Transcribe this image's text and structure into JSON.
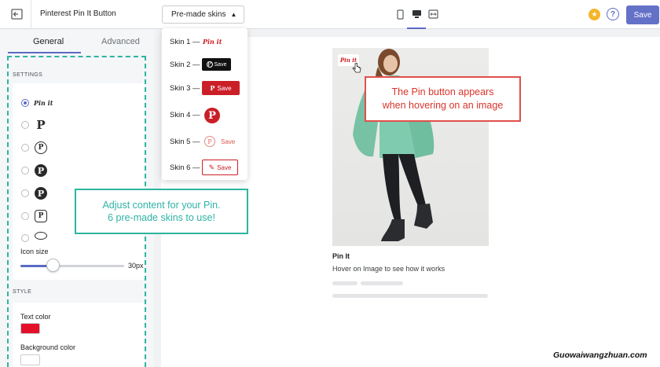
{
  "topbar": {
    "app_title": "Pinterest Pin It Button",
    "skins_button": "Pre-made skins",
    "save_label": "Save"
  },
  "tabs": [
    "General",
    "Advanced"
  ],
  "settings": {
    "section_label": "SETTINGS",
    "first_option": "Pin it",
    "icon_size_label": "Icon size",
    "icon_size_value": "30px",
    "icon_size_fraction": 0.31
  },
  "style": {
    "section_label": "STYLE",
    "text_color_label": "Text color",
    "text_color": "#e4102a",
    "background_color_label": "Background color",
    "background_color": "#ffffff"
  },
  "skins_menu": {
    "items": [
      "Skin 1 —",
      "Skin 2 —",
      "Skin 3 —",
      "Skin 4 —",
      "Skin 5 —",
      "Skin 6 —"
    ],
    "pin_it_text": "Pin it",
    "save_text": "Save",
    "p_glyph": "P"
  },
  "preview": {
    "pin_badge": "Pin it",
    "card_title": "Pin It",
    "card_desc": "Hover on Image to see how it works"
  },
  "callouts": {
    "pin_hover_line1": "The Pin button appears",
    "pin_hover_line2": "when hovering on an image",
    "adjust_line1": "Adjust content for your Pin.",
    "adjust_line2": "6 pre-made skins to use!"
  },
  "watermark": "Guowaiwangzhuan.com",
  "colors": {
    "accent": "#5c6ac4",
    "pinterest_red": "#cb1f27",
    "callout_green": "#2db5a0",
    "callout_red": "#e0504a"
  }
}
